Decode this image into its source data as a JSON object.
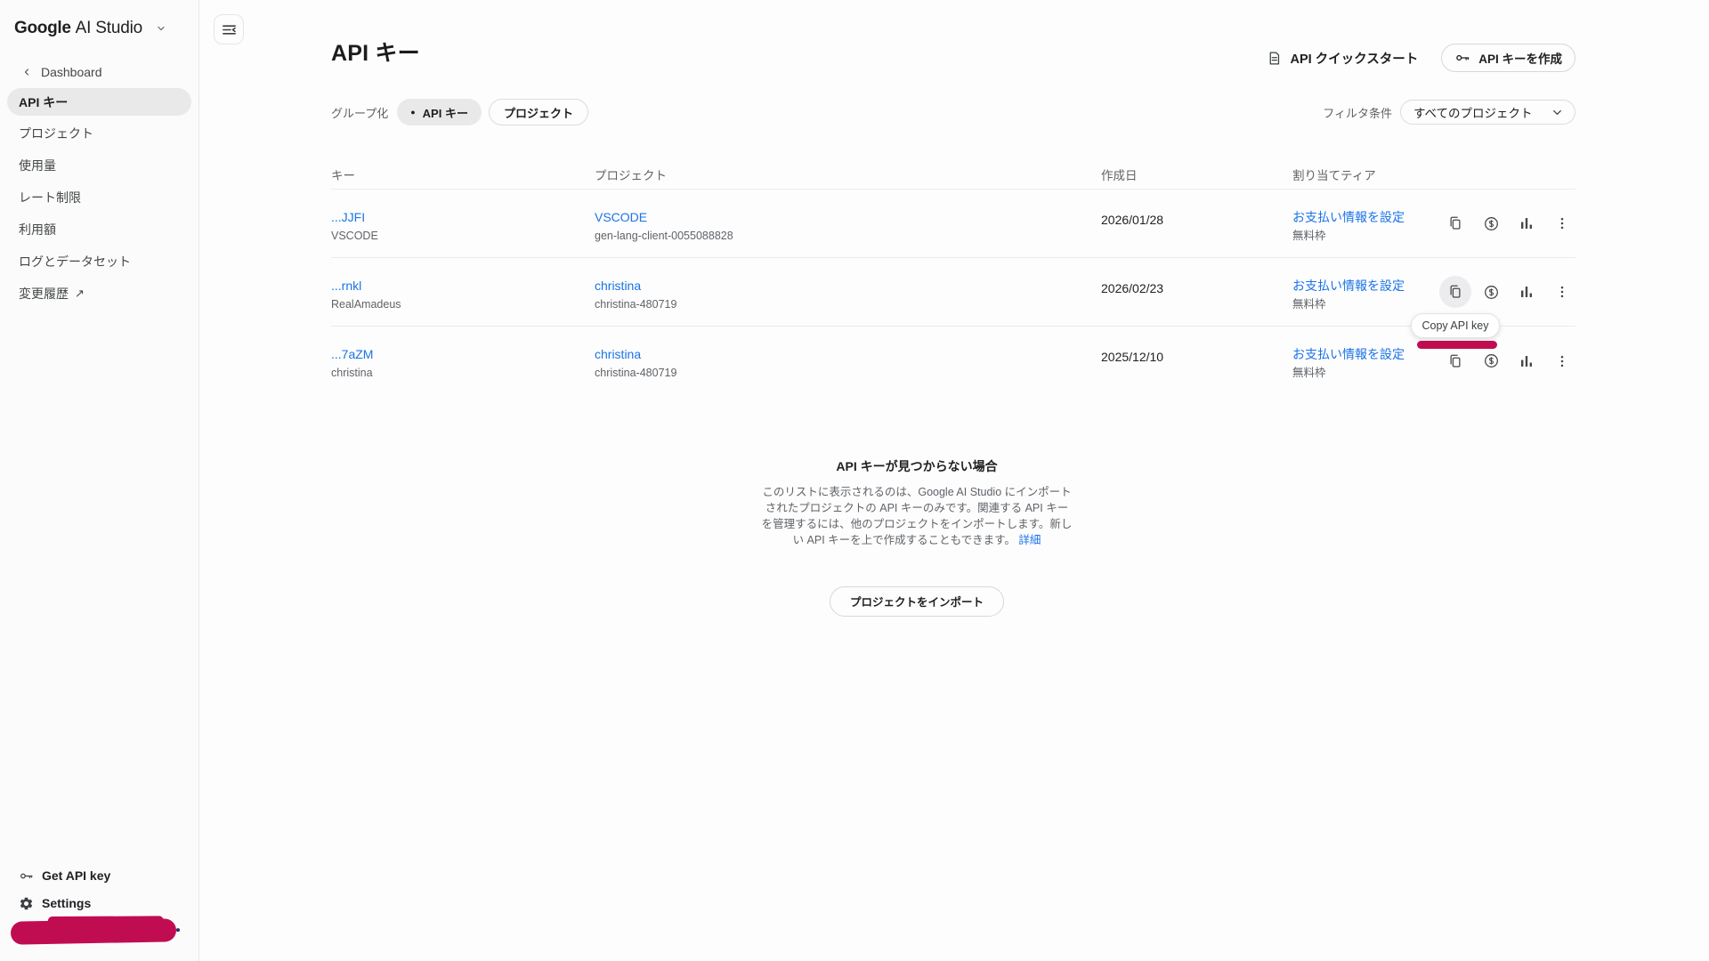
{
  "brand": {
    "google": "Google",
    "suffix": "AI Studio"
  },
  "sidebar": {
    "back_label": "Dashboard",
    "items": [
      {
        "label": "API キー",
        "active": true
      },
      {
        "label": "プロジェクト"
      },
      {
        "label": "使用量"
      },
      {
        "label": "レート制限"
      },
      {
        "label": "利用額"
      },
      {
        "label": "ログとデータセット"
      },
      {
        "label": "変更履歴"
      }
    ],
    "footer": [
      {
        "label": "Get API key"
      },
      {
        "label": "Settings"
      }
    ]
  },
  "header": {
    "title": "API キー",
    "quickstart_label": "API クイックスタート",
    "create_label": "API キーを作成"
  },
  "filters": {
    "group_label": "グループ化",
    "toggles": [
      {
        "label": "API キー",
        "selected": true
      },
      {
        "label": "プロジェクト",
        "selected": false
      }
    ],
    "filter_label": "フィルタ条件",
    "filter_value": "すべてのプロジェクト"
  },
  "table": {
    "columns": [
      "キー",
      "プロジェクト",
      "作成日",
      "割り当てティア"
    ],
    "rows": [
      {
        "key": "...JJFI",
        "key_sub": "VSCODE",
        "project": "VSCODE",
        "project_sub": "gen-lang-client-0055088828",
        "created": "2026/01/28",
        "tier_link": "お支払い情報を設定",
        "tier_sub": "無料枠"
      },
      {
        "key": "...rnkl",
        "key_sub": "RealAmadeus",
        "project": "christina",
        "project_sub": "christina-480719",
        "created": "2026/02/23",
        "tier_link": "お支払い情報を設定",
        "tier_sub": "無料枠"
      },
      {
        "key": "...7aZM",
        "key_sub": "christina",
        "project": "christina",
        "project_sub": "christina-480719",
        "created": "2025/12/10",
        "tier_link": "お支払い情報を設定",
        "tier_sub": "無料枠"
      }
    ]
  },
  "tooltip": {
    "text": "Copy API key"
  },
  "empty_state": {
    "title": "API キーが見つからない場合",
    "body": "このリストに表示されるのは、Google AI Studio にインポートされたプロジェクトの API キーのみです。関連する API キーを管理するには、他のプロジェクトをインポートします。新しい API キーを上で作成することもできます。",
    "link": "詳細",
    "button": "プロジェクトをインポート"
  },
  "icons": {
    "dot": "●",
    "external": "↗"
  },
  "colors": {
    "link_blue": "#1A73E8",
    "annotation_pink": "#C00D52",
    "text_primary": "#1F1F1F",
    "text_secondary": "#5F6368"
  }
}
